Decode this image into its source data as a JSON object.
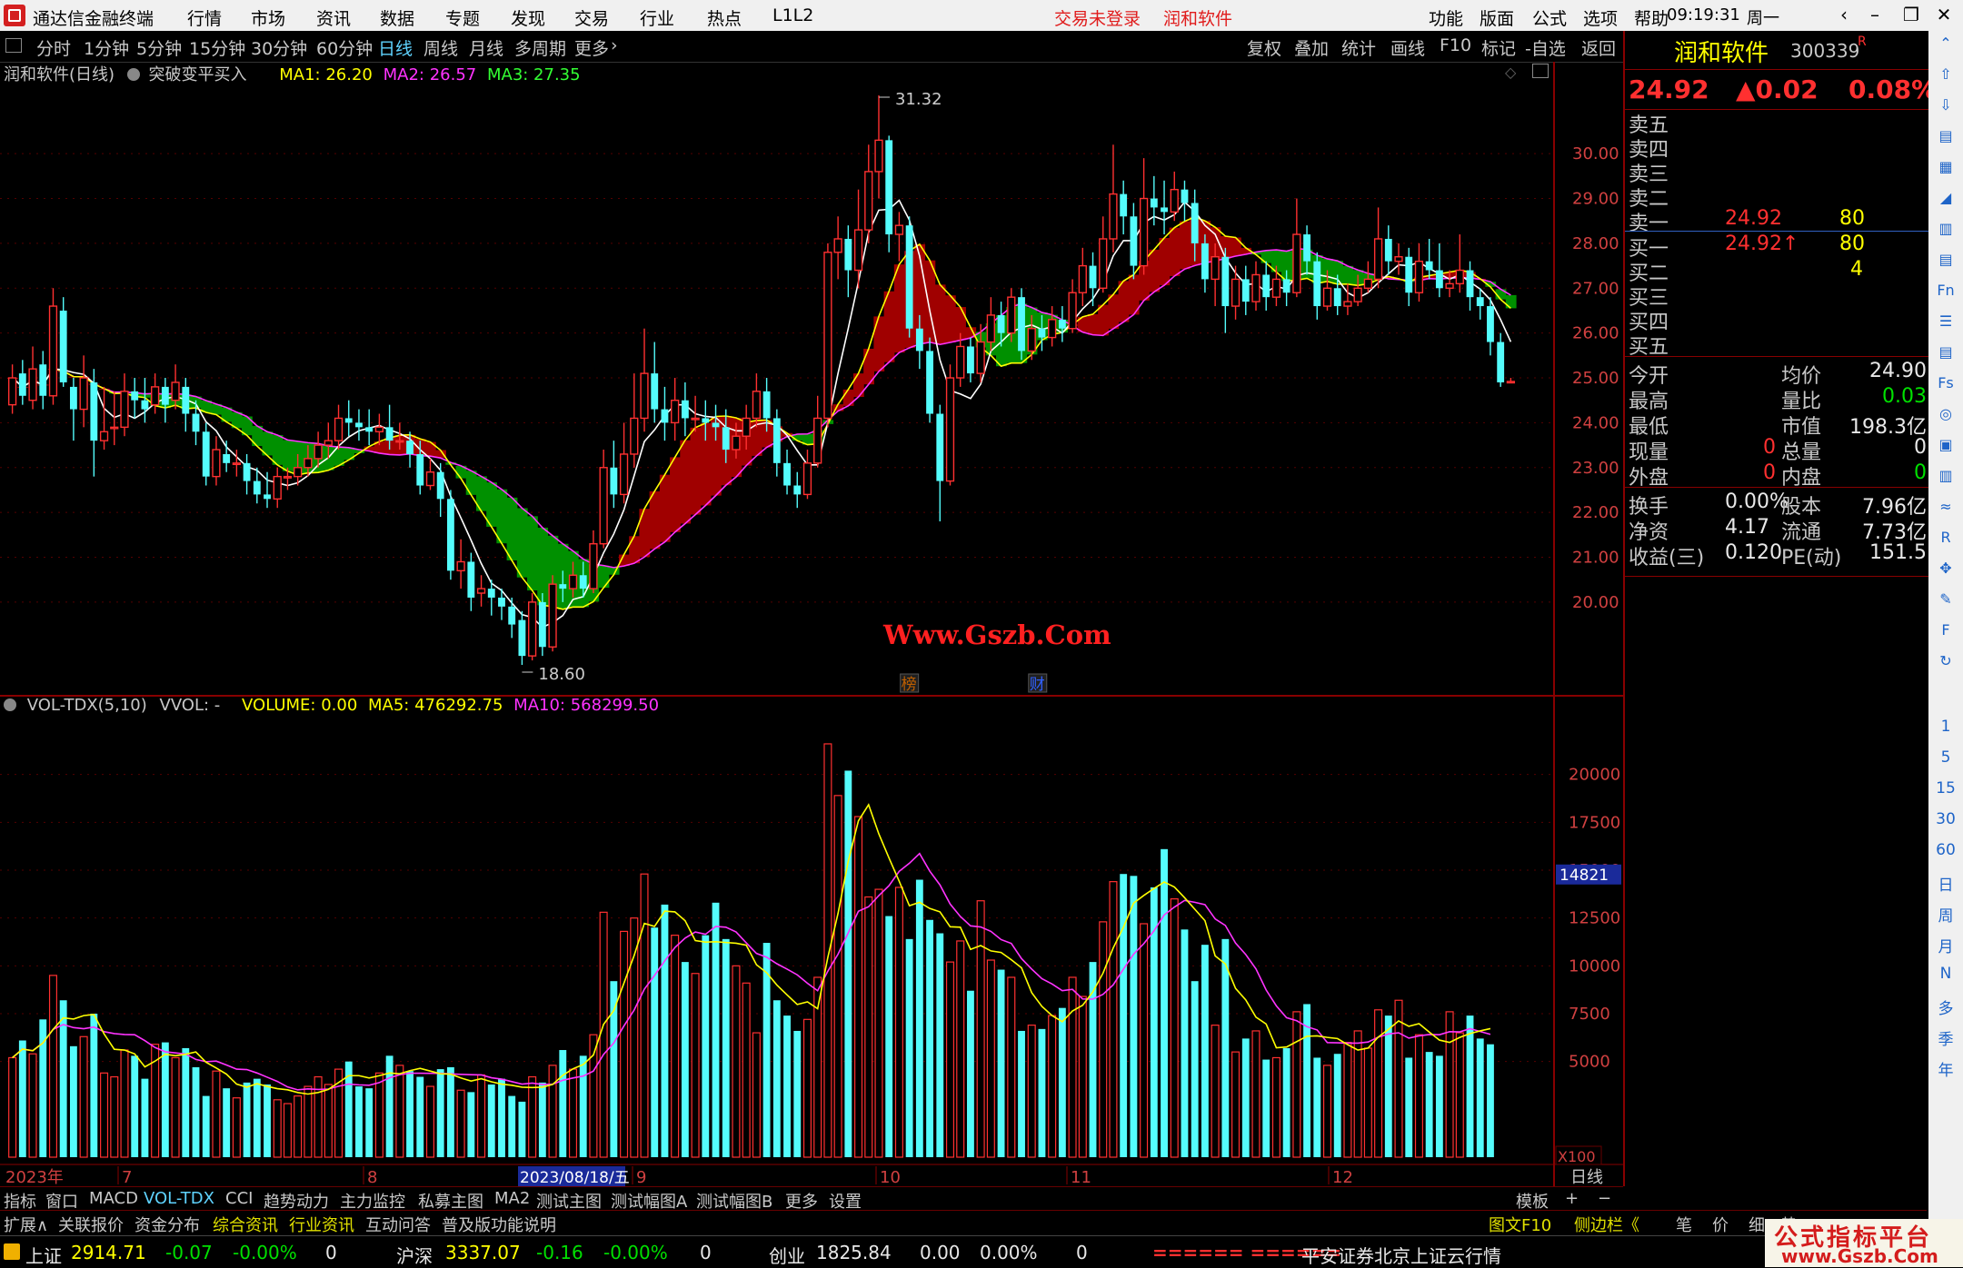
{
  "titlebar": {
    "app_title": "通达信金融终端",
    "menu": [
      "行情",
      "市场",
      "资讯",
      "数据",
      "专题",
      "发现",
      "交易",
      "行业",
      "热点",
      "L1L2"
    ],
    "login_status": "交易未登录",
    "stock_name": "润和软件",
    "right_menu": [
      "功能",
      "版面",
      "公式",
      "选项",
      "帮助"
    ],
    "time": "09:19:31",
    "weekday": "周一"
  },
  "period_tabs": [
    "分时",
    "1分钟",
    "5分钟",
    "15分钟",
    "30分钟",
    "60分钟",
    "日线",
    "周线",
    "月线",
    "多周期",
    "更多"
  ],
  "active_period": "日线",
  "right_tabs": [
    "复权",
    "叠加",
    "统计",
    "画线",
    "F10",
    "标记",
    "-自选",
    "返回"
  ],
  "main_info": {
    "title": "润和软件(日线)",
    "indicator": "突破变平买入",
    "ma1": "MA1: 26.20",
    "ma2": "MA2: 26.57",
    "ma3": "MA3: 27.35"
  },
  "vol_info": {
    "name": "VOL-TDX(5,10)",
    "vvol": "VVOL: -",
    "volume": "VOLUME: 0.00",
    "ma5": "MA5: 476292.75",
    "ma10": "MA10: 568299.50"
  },
  "markers": {
    "high": "31.32",
    "low": "18.60",
    "bang": "榜",
    "cai": "财"
  },
  "price_axis": [
    "30.00",
    "29.00",
    "28.00",
    "27.00",
    "26.00",
    "25.00",
    "24.00",
    "23.00",
    "22.00",
    "21.00",
    "20.00"
  ],
  "vol_axis": [
    "20000",
    "17500",
    "15000",
    "12500",
    "10000",
    "7500",
    "5000"
  ],
  "vol_cursor": "14821",
  "vol_unit": "X100",
  "time_axis": {
    "year": "2023年",
    "months": [
      "7",
      "8",
      "9",
      "10",
      "11",
      "12"
    ],
    "cursor_date": "2023/08/18/五",
    "period": "日线"
  },
  "bottom_tabs": [
    "指标",
    "窗口",
    "MACD",
    "VOL-TDX",
    "CCI",
    "趋势动力",
    "主力监控",
    "私募主图",
    "MA2",
    "测试主图",
    "测试幅图A",
    "测试幅图B",
    "更多",
    "设置"
  ],
  "active_bottom_tab": "VOL-TDX",
  "bottom_right": [
    "模板",
    "+",
    "−"
  ],
  "bottom_tabs2": [
    "扩展∧",
    "关联报价",
    "资金分布",
    "综合资讯",
    "行业资讯",
    "互动问答",
    "普及版功能说明"
  ],
  "bottom_tabs2_right": [
    "图文F10",
    "侧边栏《",
    "笔",
    "价",
    "细",
    "势"
  ],
  "statusbar": {
    "sh_name": "上证",
    "sh_val": "2914.71",
    "sh_chg": "-0.07",
    "sh_pct": "-0.00%",
    "sh_amt": "0",
    "hs_name": "沪深",
    "hs_val": "3337.07",
    "hs_chg": "-0.16",
    "hs_pct": "-0.00%",
    "hs_amt": "0",
    "cy_name": "创业",
    "cy_val": "1825.84",
    "cy_chg": "0.00",
    "cy_pct": "0.00%",
    "cy_amt": "0",
    "bars": "====== ======",
    "server": "平安证券北京上证云行情"
  },
  "quote": {
    "name": "润和软件",
    "code": "300339",
    "badge": "R",
    "price": "24.92",
    "change": "▲0.02",
    "pct": "0.08%",
    "asks": [
      "卖五",
      "卖四",
      "卖三",
      "卖二",
      "卖一"
    ],
    "ask1_price": "24.92",
    "ask1_vol": "80",
    "bids": [
      "买一",
      "买二",
      "买三",
      "买四",
      "买五"
    ],
    "bid1_price": "24.92↑",
    "bid1_vol": "80",
    "bid2_vol": "4",
    "stats": [
      [
        "今开",
        "",
        "均价",
        "24.90"
      ],
      [
        "最高",
        "",
        "量比",
        "0.03"
      ],
      [
        "最低",
        "",
        "市值",
        "198.3亿"
      ],
      [
        "现量",
        "0",
        "总量",
        "0"
      ],
      [
        "外盘",
        "0",
        "内盘",
        "0"
      ]
    ],
    "stats2": [
      [
        "换手",
        "0.00%",
        "股本",
        "7.96亿"
      ],
      [
        "净资",
        "4.17",
        "流通",
        "7.73亿"
      ],
      [
        "收益(三)",
        "0.120",
        "PE(动)",
        "151.5"
      ]
    ]
  },
  "toolbar_text": [
    "1",
    "5",
    "15",
    "30",
    "60",
    "日",
    "周",
    "月",
    "N",
    "多",
    "季",
    "年"
  ],
  "watermark": "Www.Gszb.Com",
  "brand": {
    "line1": "公式指标平台",
    "line2": "www.Gszb.Com"
  },
  "colors": {
    "up": "#ff3030",
    "down": "#54fcfc",
    "ma_yellow": "#ffff00",
    "ma_pink": "#ff33ff",
    "fill_red": "#a00000",
    "fill_green": "#009000"
  },
  "chart_data": {
    "type": "candlestick",
    "price_range": [
      19.0,
      31.6
    ],
    "candles": [
      {
        "o": 24.4,
        "c": 25.0,
        "h": 25.3,
        "l": 24.2
      },
      {
        "o": 25.1,
        "c": 24.6,
        "h": 25.4,
        "l": 24.4
      },
      {
        "o": 24.5,
        "c": 25.2,
        "h": 25.7,
        "l": 24.3
      },
      {
        "o": 25.3,
        "c": 24.6,
        "h": 25.6,
        "l": 24.3
      },
      {
        "o": 24.6,
        "c": 26.6,
        "h": 27.0,
        "l": 24.4
      },
      {
        "o": 26.5,
        "c": 24.9,
        "h": 26.8,
        "l": 24.8
      },
      {
        "o": 24.8,
        "c": 24.3,
        "h": 25.0,
        "l": 23.6
      },
      {
        "o": 24.3,
        "c": 25.0,
        "h": 25.5,
        "l": 23.9
      },
      {
        "o": 24.9,
        "c": 23.6,
        "h": 25.2,
        "l": 22.8
      },
      {
        "o": 23.6,
        "c": 23.8,
        "h": 24.8,
        "l": 23.4
      },
      {
        "o": 23.9,
        "c": 23.9,
        "h": 24.7,
        "l": 23.5
      },
      {
        "o": 23.9,
        "c": 24.7,
        "h": 25.1,
        "l": 23.7
      },
      {
        "o": 24.7,
        "c": 24.5,
        "h": 25.0,
        "l": 24.1
      },
      {
        "o": 24.5,
        "c": 24.3,
        "h": 25.0,
        "l": 24.0
      },
      {
        "o": 24.4,
        "c": 24.8,
        "h": 25.1,
        "l": 24.2
      },
      {
        "o": 24.8,
        "c": 24.4,
        "h": 25.0,
        "l": 24.0
      },
      {
        "o": 24.5,
        "c": 24.9,
        "h": 25.3,
        "l": 24.3
      },
      {
        "o": 24.8,
        "c": 24.2,
        "h": 25.0,
        "l": 23.8
      },
      {
        "o": 24.2,
        "c": 23.8,
        "h": 24.5,
        "l": 23.5
      },
      {
        "o": 23.8,
        "c": 22.8,
        "h": 24.0,
        "l": 22.6
      },
      {
        "o": 22.8,
        "c": 23.4,
        "h": 23.7,
        "l": 22.6
      },
      {
        "o": 23.3,
        "c": 23.1,
        "h": 23.6,
        "l": 22.9
      },
      {
        "o": 23.1,
        "c": 23.1,
        "h": 23.4,
        "l": 22.8
      },
      {
        "o": 23.1,
        "c": 22.7,
        "h": 23.3,
        "l": 22.4
      },
      {
        "o": 22.7,
        "c": 22.4,
        "h": 23.0,
        "l": 22.2
      },
      {
        "o": 22.4,
        "c": 22.3,
        "h": 22.9,
        "l": 22.1
      },
      {
        "o": 22.3,
        "c": 22.8,
        "h": 23.0,
        "l": 22.1
      },
      {
        "o": 22.8,
        "c": 22.8,
        "h": 23.0,
        "l": 22.5
      },
      {
        "o": 22.8,
        "c": 23.0,
        "h": 23.3,
        "l": 22.6
      },
      {
        "o": 23.0,
        "c": 23.2,
        "h": 23.5,
        "l": 22.8
      },
      {
        "o": 23.2,
        "c": 23.5,
        "h": 23.8,
        "l": 23.0
      },
      {
        "o": 23.5,
        "c": 23.6,
        "h": 24.0,
        "l": 23.2
      },
      {
        "o": 23.6,
        "c": 24.1,
        "h": 24.4,
        "l": 23.4
      },
      {
        "o": 24.1,
        "c": 24.0,
        "h": 24.5,
        "l": 23.7
      },
      {
        "o": 24.0,
        "c": 23.9,
        "h": 24.3,
        "l": 23.6
      },
      {
        "o": 23.9,
        "c": 23.8,
        "h": 24.3,
        "l": 23.5
      },
      {
        "o": 23.8,
        "c": 23.9,
        "h": 24.2,
        "l": 23.5
      },
      {
        "o": 23.9,
        "c": 23.6,
        "h": 24.4,
        "l": 23.4
      },
      {
        "o": 23.6,
        "c": 23.6,
        "h": 24.0,
        "l": 23.4
      },
      {
        "o": 23.6,
        "c": 23.3,
        "h": 23.8,
        "l": 23.0
      },
      {
        "o": 23.3,
        "c": 22.6,
        "h": 23.6,
        "l": 22.4
      },
      {
        "o": 22.6,
        "c": 22.9,
        "h": 23.2,
        "l": 22.5
      },
      {
        "o": 22.9,
        "c": 22.3,
        "h": 23.1,
        "l": 21.9
      },
      {
        "o": 22.3,
        "c": 20.7,
        "h": 22.5,
        "l": 20.5
      },
      {
        "o": 20.7,
        "c": 20.9,
        "h": 21.4,
        "l": 20.3
      },
      {
        "o": 20.9,
        "c": 20.1,
        "h": 21.1,
        "l": 19.8
      },
      {
        "o": 20.2,
        "c": 20.3,
        "h": 20.6,
        "l": 19.9
      },
      {
        "o": 20.3,
        "c": 20.1,
        "h": 20.5,
        "l": 19.7
      },
      {
        "o": 20.1,
        "c": 19.9,
        "h": 20.3,
        "l": 19.6
      },
      {
        "o": 19.9,
        "c": 19.5,
        "h": 20.1,
        "l": 19.2
      },
      {
        "o": 19.6,
        "c": 18.8,
        "h": 19.8,
        "l": 18.6
      },
      {
        "o": 18.8,
        "c": 20.0,
        "h": 20.2,
        "l": 18.7
      },
      {
        "o": 20.0,
        "c": 19.0,
        "h": 20.2,
        "l": 18.8
      },
      {
        "o": 19.0,
        "c": 20.4,
        "h": 20.6,
        "l": 18.9
      },
      {
        "o": 20.4,
        "c": 20.3,
        "h": 20.7,
        "l": 20.0
      },
      {
        "o": 20.3,
        "c": 20.6,
        "h": 20.9,
        "l": 20.1
      },
      {
        "o": 20.6,
        "c": 20.3,
        "h": 20.9,
        "l": 20.1
      },
      {
        "o": 20.3,
        "c": 21.3,
        "h": 21.6,
        "l": 20.2
      },
      {
        "o": 21.3,
        "c": 23.0,
        "h": 23.4,
        "l": 21.2
      },
      {
        "o": 23.0,
        "c": 22.4,
        "h": 23.6,
        "l": 22.1
      },
      {
        "o": 22.4,
        "c": 23.3,
        "h": 24.0,
        "l": 22.2
      },
      {
        "o": 23.3,
        "c": 24.1,
        "h": 25.1,
        "l": 23.0
      },
      {
        "o": 24.1,
        "c": 25.1,
        "h": 26.1,
        "l": 23.8
      },
      {
        "o": 25.1,
        "c": 24.3,
        "h": 25.8,
        "l": 24.0
      },
      {
        "o": 24.3,
        "c": 24.0,
        "h": 24.8,
        "l": 23.6
      },
      {
        "o": 24.0,
        "c": 24.5,
        "h": 25.0,
        "l": 23.6
      },
      {
        "o": 24.5,
        "c": 24.1,
        "h": 24.9,
        "l": 23.7
      },
      {
        "o": 24.1,
        "c": 24.1,
        "h": 24.6,
        "l": 23.8
      },
      {
        "o": 24.1,
        "c": 24.0,
        "h": 24.5,
        "l": 23.6
      },
      {
        "o": 24.0,
        "c": 23.9,
        "h": 24.4,
        "l": 23.6
      },
      {
        "o": 23.9,
        "c": 23.4,
        "h": 24.3,
        "l": 23.1
      },
      {
        "o": 23.4,
        "c": 23.7,
        "h": 24.0,
        "l": 23.2
      },
      {
        "o": 23.7,
        "c": 24.1,
        "h": 24.4,
        "l": 23.4
      },
      {
        "o": 24.1,
        "c": 24.7,
        "h": 25.1,
        "l": 23.9
      },
      {
        "o": 24.7,
        "c": 24.1,
        "h": 25.0,
        "l": 23.8
      },
      {
        "o": 24.1,
        "c": 23.1,
        "h": 24.3,
        "l": 22.8
      },
      {
        "o": 23.1,
        "c": 22.6,
        "h": 23.4,
        "l": 22.4
      },
      {
        "o": 22.6,
        "c": 22.4,
        "h": 22.9,
        "l": 22.1
      },
      {
        "o": 22.4,
        "c": 23.1,
        "h": 23.4,
        "l": 22.3
      },
      {
        "o": 23.1,
        "c": 24.1,
        "h": 24.6,
        "l": 23.0
      },
      {
        "o": 24.1,
        "c": 27.8,
        "h": 28.0,
        "l": 23.9
      },
      {
        "o": 27.8,
        "c": 28.1,
        "h": 28.6,
        "l": 27.2
      },
      {
        "o": 28.1,
        "c": 27.4,
        "h": 28.4,
        "l": 26.8
      },
      {
        "o": 27.4,
        "c": 28.3,
        "h": 29.2,
        "l": 27.0
      },
      {
        "o": 28.3,
        "c": 29.6,
        "h": 30.2,
        "l": 28.0
      },
      {
        "o": 29.6,
        "c": 30.3,
        "h": 31.3,
        "l": 29.0
      },
      {
        "o": 30.3,
        "c": 28.2,
        "h": 30.4,
        "l": 27.8
      },
      {
        "o": 28.2,
        "c": 28.4,
        "h": 28.7,
        "l": 27.6
      },
      {
        "o": 28.4,
        "c": 26.1,
        "h": 28.6,
        "l": 25.9
      },
      {
        "o": 26.1,
        "c": 25.6,
        "h": 26.4,
        "l": 25.2
      },
      {
        "o": 25.6,
        "c": 24.2,
        "h": 25.9,
        "l": 24.0
      },
      {
        "o": 24.2,
        "c": 22.7,
        "h": 24.4,
        "l": 21.8
      },
      {
        "o": 22.7,
        "c": 25.0,
        "h": 25.3,
        "l": 22.6
      },
      {
        "o": 25.0,
        "c": 25.7,
        "h": 26.0,
        "l": 24.8
      },
      {
        "o": 25.7,
        "c": 25.1,
        "h": 25.9,
        "l": 24.9
      },
      {
        "o": 25.1,
        "c": 25.8,
        "h": 26.2,
        "l": 24.9
      },
      {
        "o": 25.8,
        "c": 26.4,
        "h": 26.8,
        "l": 25.6
      },
      {
        "o": 26.4,
        "c": 26.0,
        "h": 26.7,
        "l": 25.7
      },
      {
        "o": 26.0,
        "c": 26.8,
        "h": 27.0,
        "l": 25.8
      },
      {
        "o": 26.8,
        "c": 25.6,
        "h": 27.0,
        "l": 25.4
      },
      {
        "o": 25.6,
        "c": 26.1,
        "h": 26.4,
        "l": 25.4
      },
      {
        "o": 26.1,
        "c": 25.9,
        "h": 26.4,
        "l": 25.6
      },
      {
        "o": 25.9,
        "c": 26.3,
        "h": 26.6,
        "l": 25.7
      },
      {
        "o": 26.3,
        "c": 26.1,
        "h": 26.6,
        "l": 25.8
      },
      {
        "o": 26.1,
        "c": 26.9,
        "h": 27.2,
        "l": 26.0
      },
      {
        "o": 26.9,
        "c": 27.5,
        "h": 27.9,
        "l": 26.6
      },
      {
        "o": 27.5,
        "c": 27.0,
        "h": 27.8,
        "l": 26.6
      },
      {
        "o": 27.0,
        "c": 28.1,
        "h": 28.6,
        "l": 26.9
      },
      {
        "o": 28.1,
        "c": 29.1,
        "h": 30.2,
        "l": 27.8
      },
      {
        "o": 29.1,
        "c": 28.6,
        "h": 29.4,
        "l": 28.2
      },
      {
        "o": 28.6,
        "c": 27.5,
        "h": 28.9,
        "l": 27.2
      },
      {
        "o": 27.5,
        "c": 29.0,
        "h": 29.9,
        "l": 27.3
      },
      {
        "o": 29.0,
        "c": 28.8,
        "h": 29.5,
        "l": 28.4
      },
      {
        "o": 28.8,
        "c": 28.7,
        "h": 29.4,
        "l": 28.2
      },
      {
        "o": 28.7,
        "c": 29.2,
        "h": 29.6,
        "l": 28.5
      },
      {
        "o": 29.2,
        "c": 28.9,
        "h": 29.4,
        "l": 28.5
      },
      {
        "o": 28.9,
        "c": 28.0,
        "h": 29.2,
        "l": 27.6
      },
      {
        "o": 28.0,
        "c": 27.2,
        "h": 28.2,
        "l": 26.9
      },
      {
        "o": 27.2,
        "c": 27.7,
        "h": 28.0,
        "l": 26.6
      },
      {
        "o": 27.7,
        "c": 26.6,
        "h": 27.9,
        "l": 26.0
      },
      {
        "o": 26.6,
        "c": 27.2,
        "h": 27.5,
        "l": 26.3
      },
      {
        "o": 27.2,
        "c": 26.7,
        "h": 27.5,
        "l": 26.4
      },
      {
        "o": 26.7,
        "c": 27.3,
        "h": 27.6,
        "l": 26.5
      },
      {
        "o": 27.3,
        "c": 26.8,
        "h": 27.6,
        "l": 26.5
      },
      {
        "o": 26.8,
        "c": 27.2,
        "h": 27.5,
        "l": 26.6
      },
      {
        "o": 27.2,
        "c": 26.9,
        "h": 27.4,
        "l": 26.6
      },
      {
        "o": 26.9,
        "c": 28.2,
        "h": 29.0,
        "l": 26.8
      },
      {
        "o": 28.2,
        "c": 27.6,
        "h": 28.4,
        "l": 27.3
      },
      {
        "o": 27.6,
        "c": 26.6,
        "h": 27.8,
        "l": 26.3
      },
      {
        "o": 26.6,
        "c": 27.0,
        "h": 27.4,
        "l": 26.5
      },
      {
        "o": 27.0,
        "c": 26.6,
        "h": 27.3,
        "l": 26.4
      },
      {
        "o": 26.6,
        "c": 26.7,
        "h": 27.1,
        "l": 26.4
      },
      {
        "o": 26.7,
        "c": 27.0,
        "h": 27.3,
        "l": 26.6
      },
      {
        "o": 27.0,
        "c": 27.2,
        "h": 27.6,
        "l": 26.9
      },
      {
        "o": 27.2,
        "c": 28.1,
        "h": 28.8,
        "l": 27.0
      },
      {
        "o": 28.1,
        "c": 27.6,
        "h": 28.4,
        "l": 27.3
      },
      {
        "o": 27.6,
        "c": 27.7,
        "h": 28.0,
        "l": 27.3
      },
      {
        "o": 27.7,
        "c": 26.9,
        "h": 27.9,
        "l": 26.6
      },
      {
        "o": 26.9,
        "c": 27.6,
        "h": 28.0,
        "l": 26.7
      },
      {
        "o": 27.6,
        "c": 27.4,
        "h": 28.1,
        "l": 27.2
      },
      {
        "o": 27.4,
        "c": 27.0,
        "h": 28.0,
        "l": 26.8
      },
      {
        "o": 27.0,
        "c": 27.1,
        "h": 27.4,
        "l": 26.8
      },
      {
        "o": 27.1,
        "c": 27.4,
        "h": 28.2,
        "l": 26.9
      },
      {
        "o": 27.4,
        "c": 26.8,
        "h": 27.6,
        "l": 26.5
      },
      {
        "o": 26.8,
        "c": 26.6,
        "h": 27.0,
        "l": 26.3
      },
      {
        "o": 26.6,
        "c": 25.8,
        "h": 26.8,
        "l": 25.5
      },
      {
        "o": 25.8,
        "c": 24.9,
        "h": 26.0,
        "l": 24.8
      },
      {
        "o": 24.9,
        "c": 24.92,
        "h": 25.0,
        "l": 24.9
      }
    ],
    "volumes": [
      5200,
      6100,
      5400,
      7200,
      9500,
      8200,
      5800,
      6300,
      7500,
      4400,
      4200,
      5600,
      5300,
      4100,
      5900,
      6000,
      5200,
      5700,
      4700,
      3200,
      4500,
      3600,
      3100,
      3900,
      4100,
      3800,
      3000,
      2800,
      3200,
      3700,
      4200,
      3800,
      4600,
      5000,
      3700,
      3600,
      4400,
      5300,
      4800,
      4500,
      4200,
      3700,
      4600,
      4700,
      3500,
      3400,
      4300,
      3800,
      4100,
      3200,
      2900,
      4200,
      3900,
      4800,
      5600,
      4600,
      5300,
      6400,
      12800,
      9200,
      11800,
      12500,
      14800,
      12000,
      13200,
      11600,
      10200,
      9600,
      11600,
      13300,
      11400,
      10000,
      9100,
      6500,
      11200,
      8200,
      7400,
      6600,
      7200,
      9400,
      21600,
      18900,
      20200,
      17800,
      13600,
      14000,
      12600,
      14100,
      11400,
      14500,
      12400,
      11700,
      10200,
      11300,
      8700,
      13400,
      10300,
      9800,
      9400,
      6600,
      6900,
      6700,
      7400,
      7800,
      9400,
      8400,
      10200,
      12300,
      14400,
      14800,
      14700,
      12200,
      14100,
      16100,
      13500,
      11900,
      9200,
      11100,
      6900,
      11400,
      5500,
      6200,
      6600,
      5100,
      5200,
      5700,
      7600,
      8000,
      5200,
      4800,
      5400,
      6000,
      6600,
      5700,
      7700,
      7400,
      8200,
      5200,
      6400,
      5500,
      5300,
      7600,
      6500,
      7400,
      6200,
      5900
    ],
    "ma5": [],
    "ma10": []
  }
}
